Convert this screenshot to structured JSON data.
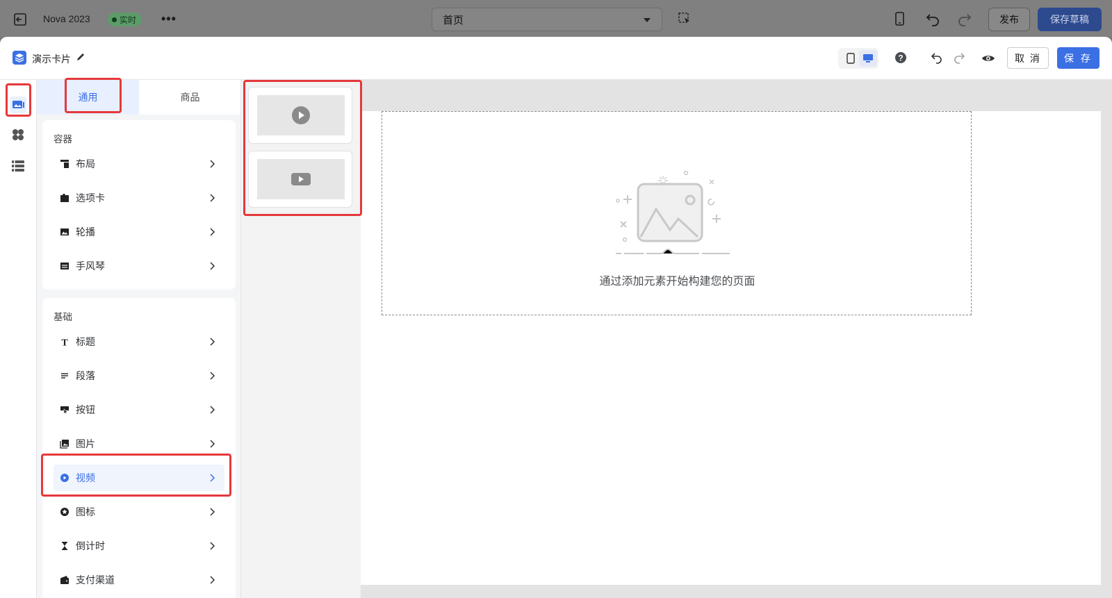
{
  "topbar": {
    "store_name": "Nova 2023",
    "live_badge": "实时",
    "more": "•••",
    "page_select": "首页",
    "publish_label": "发布",
    "save_draft_label": "保存草稿"
  },
  "modal": {
    "title": "演示卡片",
    "cancel_label": "取 消",
    "save_label": "保 存"
  },
  "tabs": [
    {
      "label": "通用",
      "active": true
    },
    {
      "label": "商品",
      "active": false
    }
  ],
  "groups": {
    "containers": {
      "title": "容器",
      "items": [
        {
          "label": "布局",
          "icon": "layout-icon"
        },
        {
          "label": "选项卡",
          "icon": "tabs-icon"
        },
        {
          "label": "轮播",
          "icon": "carousel-icon"
        },
        {
          "label": "手风琴",
          "icon": "accordion-icon"
        }
      ]
    },
    "basics": {
      "title": "基础",
      "items": [
        {
          "label": "标题",
          "icon": "heading-icon"
        },
        {
          "label": "段落",
          "icon": "paragraph-icon"
        },
        {
          "label": "按钮",
          "icon": "button-icon"
        },
        {
          "label": "图片",
          "icon": "image-icon"
        },
        {
          "label": "视频",
          "icon": "video-icon",
          "selected": true
        },
        {
          "label": "图标",
          "icon": "star-icon"
        },
        {
          "label": "倒计时",
          "icon": "hourglass-icon"
        },
        {
          "label": "支付渠道",
          "icon": "wallet-icon"
        }
      ]
    }
  },
  "canvas": {
    "empty_message": "通过添加元素开始构建您的页面"
  },
  "colors": {
    "accent": "#3b6fe4",
    "highlight": "#e5383b",
    "live_badge": "#5e9b6a"
  }
}
